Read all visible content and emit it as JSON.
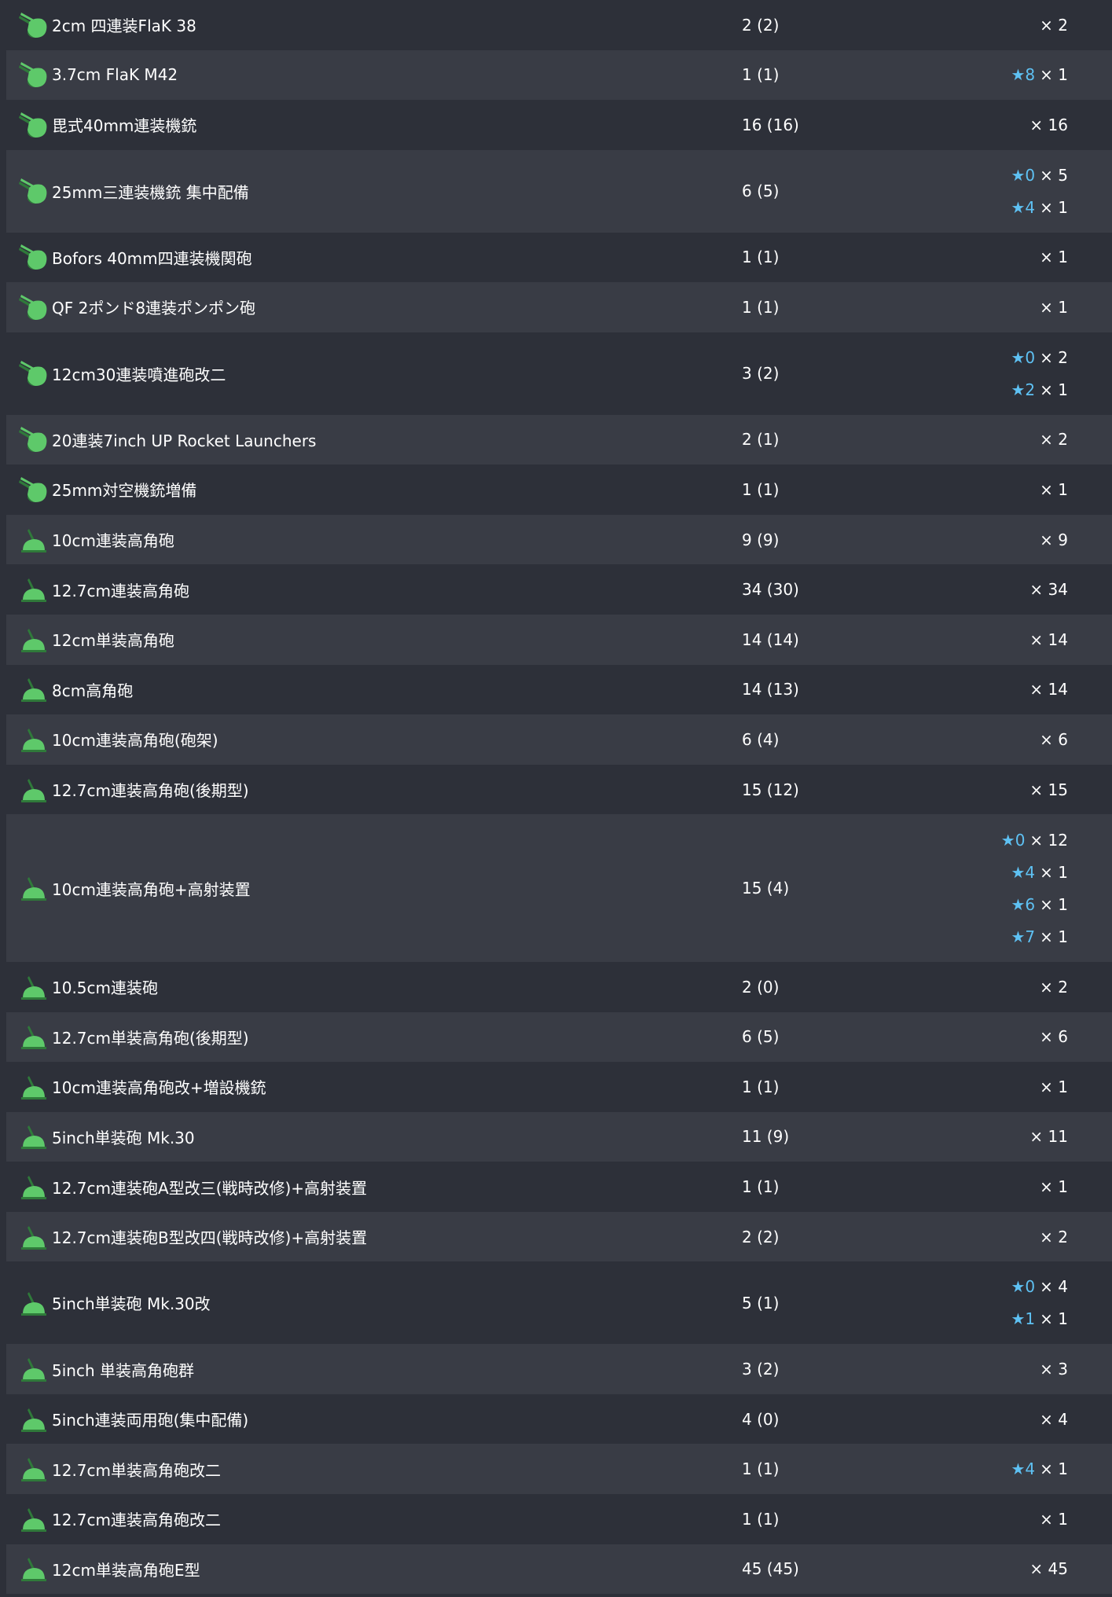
{
  "colors": {
    "row_dark": "#2d3039",
    "row_light": "#393c45",
    "star": "#5ec1f3",
    "icon_green": "#5ec96a",
    "icon_dark_green": "#2f7a3a"
  },
  "rows": [
    {
      "name": "2cm 四連装FlaK 38",
      "count": "2 (2)",
      "icon": "aa-machine-gun-icon",
      "stars": [
        {
          "star": "",
          "mult": "× 2"
        }
      ]
    },
    {
      "name": "3.7cm FlaK M42",
      "count": "1 (1)",
      "icon": "aa-machine-gun-icon",
      "stars": [
        {
          "star": "★8",
          "mult": "× 1"
        }
      ]
    },
    {
      "name": "毘式40mm連装機銃",
      "count": "16 (16)",
      "icon": "aa-machine-gun-icon",
      "stars": [
        {
          "star": "",
          "mult": "× 16"
        }
      ]
    },
    {
      "name": "25mm三連装機銃 集中配備",
      "count": "6 (5)",
      "icon": "aa-machine-gun-icon",
      "stars": [
        {
          "star": "★0",
          "mult": "× 5"
        },
        {
          "star": "★4",
          "mult": "× 1"
        }
      ]
    },
    {
      "name": "Bofors 40mm四連装機関砲",
      "count": "1 (1)",
      "icon": "aa-machine-gun-icon",
      "stars": [
        {
          "star": "",
          "mult": "× 1"
        }
      ]
    },
    {
      "name": "QF 2ポンド8連装ポンポン砲",
      "count": "1 (1)",
      "icon": "aa-machine-gun-icon",
      "stars": [
        {
          "star": "",
          "mult": "× 1"
        }
      ]
    },
    {
      "name": "12cm30連装噴進砲改二",
      "count": "3 (2)",
      "icon": "aa-machine-gun-icon",
      "stars": [
        {
          "star": "★0",
          "mult": "× 2"
        },
        {
          "star": "★2",
          "mult": "× 1"
        }
      ]
    },
    {
      "name": "20連装7inch UP Rocket Launchers",
      "count": "2 (1)",
      "icon": "aa-machine-gun-icon",
      "stars": [
        {
          "star": "",
          "mult": "× 2"
        }
      ]
    },
    {
      "name": "25mm対空機銃増備",
      "count": "1 (1)",
      "icon": "aa-machine-gun-icon",
      "stars": [
        {
          "star": "",
          "mult": "× 1"
        }
      ]
    },
    {
      "name": "10cm連装高角砲",
      "count": "9 (9)",
      "icon": "high-angle-gun-icon",
      "stars": [
        {
          "star": "",
          "mult": "× 9"
        }
      ]
    },
    {
      "name": "12.7cm連装高角砲",
      "count": "34 (30)",
      "icon": "high-angle-gun-icon",
      "stars": [
        {
          "star": "",
          "mult": "× 34"
        }
      ]
    },
    {
      "name": "12cm単装高角砲",
      "count": "14 (14)",
      "icon": "high-angle-gun-icon",
      "stars": [
        {
          "star": "",
          "mult": "× 14"
        }
      ]
    },
    {
      "name": "8cm高角砲",
      "count": "14 (13)",
      "icon": "high-angle-gun-icon",
      "stars": [
        {
          "star": "",
          "mult": "× 14"
        }
      ]
    },
    {
      "name": "10cm連装高角砲(砲架)",
      "count": "6 (4)",
      "icon": "high-angle-gun-icon",
      "stars": [
        {
          "star": "",
          "mult": "× 6"
        }
      ]
    },
    {
      "name": "12.7cm連装高角砲(後期型)",
      "count": "15 (12)",
      "icon": "high-angle-gun-icon",
      "stars": [
        {
          "star": "",
          "mult": "× 15"
        }
      ]
    },
    {
      "name": "10cm連装高角砲+高射装置",
      "count": "15 (4)",
      "icon": "high-angle-gun-icon",
      "stars": [
        {
          "star": "★0",
          "mult": "× 12"
        },
        {
          "star": "★4",
          "mult": "× 1"
        },
        {
          "star": "★6",
          "mult": "× 1"
        },
        {
          "star": "★7",
          "mult": "× 1"
        }
      ]
    },
    {
      "name": "10.5cm連装砲",
      "count": "2 (0)",
      "icon": "high-angle-gun-icon",
      "stars": [
        {
          "star": "",
          "mult": "× 2"
        }
      ]
    },
    {
      "name": "12.7cm単装高角砲(後期型)",
      "count": "6 (5)",
      "icon": "high-angle-gun-icon",
      "stars": [
        {
          "star": "",
          "mult": "× 6"
        }
      ]
    },
    {
      "name": "10cm連装高角砲改+増設機銃",
      "count": "1 (1)",
      "icon": "high-angle-gun-icon",
      "stars": [
        {
          "star": "",
          "mult": "× 1"
        }
      ]
    },
    {
      "name": "5inch単装砲 Mk.30",
      "count": "11 (9)",
      "icon": "high-angle-gun-icon",
      "stars": [
        {
          "star": "",
          "mult": "× 11"
        }
      ]
    },
    {
      "name": "12.7cm連装砲A型改三(戦時改修)+高射装置",
      "count": "1 (1)",
      "icon": "high-angle-gun-icon",
      "stars": [
        {
          "star": "",
          "mult": "× 1"
        }
      ]
    },
    {
      "name": "12.7cm連装砲B型改四(戦時改修)+高射装置",
      "count": "2 (2)",
      "icon": "high-angle-gun-icon",
      "stars": [
        {
          "star": "",
          "mult": "× 2"
        }
      ]
    },
    {
      "name": "5inch単装砲 Mk.30改",
      "count": "5 (1)",
      "icon": "high-angle-gun-icon",
      "stars": [
        {
          "star": "★0",
          "mult": "× 4"
        },
        {
          "star": "★1",
          "mult": "× 1"
        }
      ]
    },
    {
      "name": "5inch 単装高角砲群",
      "count": "3 (2)",
      "icon": "high-angle-gun-icon",
      "stars": [
        {
          "star": "",
          "mult": "× 3"
        }
      ]
    },
    {
      "name": "5inch連装両用砲(集中配備)",
      "count": "4 (0)",
      "icon": "high-angle-gun-icon",
      "stars": [
        {
          "star": "",
          "mult": "× 4"
        }
      ]
    },
    {
      "name": "12.7cm単装高角砲改二",
      "count": "1 (1)",
      "icon": "high-angle-gun-icon",
      "stars": [
        {
          "star": "★4",
          "mult": "× 1"
        }
      ]
    },
    {
      "name": "12.7cm連装高角砲改二",
      "count": "1 (1)",
      "icon": "high-angle-gun-icon",
      "stars": [
        {
          "star": "",
          "mult": "× 1"
        }
      ]
    },
    {
      "name": "12cm単装高角砲E型",
      "count": "45 (45)",
      "icon": "high-angle-gun-icon",
      "stars": [
        {
          "star": "",
          "mult": "× 45"
        }
      ]
    }
  ]
}
